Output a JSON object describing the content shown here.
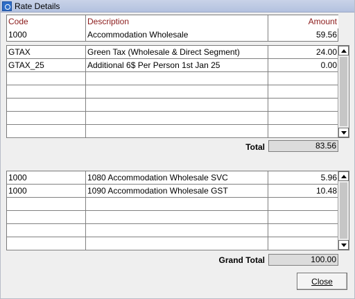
{
  "window": {
    "title": "Rate Details"
  },
  "header": {
    "code": "Code",
    "description": "Description",
    "amount": "Amount"
  },
  "base_row": {
    "code": "1000",
    "description": "Accommodation Wholesale",
    "amount": "59.56"
  },
  "taxes": [
    {
      "code": "GTAX",
      "description": "Green Tax (Wholesale & Direct Segment)",
      "amount": "24.00"
    },
    {
      "code": "GTAX_25",
      "description": "Additional 6$ Per Person 1st Jan 25",
      "amount": "0.00"
    },
    {
      "code": "",
      "description": "",
      "amount": ""
    },
    {
      "code": "",
      "description": "",
      "amount": ""
    },
    {
      "code": "",
      "description": "",
      "amount": ""
    },
    {
      "code": "",
      "description": "",
      "amount": ""
    },
    {
      "code": "",
      "description": "",
      "amount": ""
    }
  ],
  "total": {
    "label": "Total",
    "value": "83.56"
  },
  "charges": [
    {
      "code": "1000",
      "description": "1080 Accommodation Wholesale SVC",
      "amount": "5.96"
    },
    {
      "code": "1000",
      "description": "1090 Accommodation Wholesale GST",
      "amount": "10.48"
    },
    {
      "code": "",
      "description": "",
      "amount": ""
    },
    {
      "code": "",
      "description": "",
      "amount": ""
    },
    {
      "code": "",
      "description": "",
      "amount": ""
    },
    {
      "code": "",
      "description": "",
      "amount": ""
    }
  ],
  "grand_total": {
    "label": "Grand Total",
    "value": "100.00"
  },
  "buttons": {
    "close": "Close"
  },
  "icons": {
    "title": "rate-window-icon",
    "scroll_up": "arrow-up-icon",
    "scroll_down": "arrow-down-icon"
  },
  "colors": {
    "header_text": "#8b1a1a",
    "title_bar": "#b3c1df"
  }
}
